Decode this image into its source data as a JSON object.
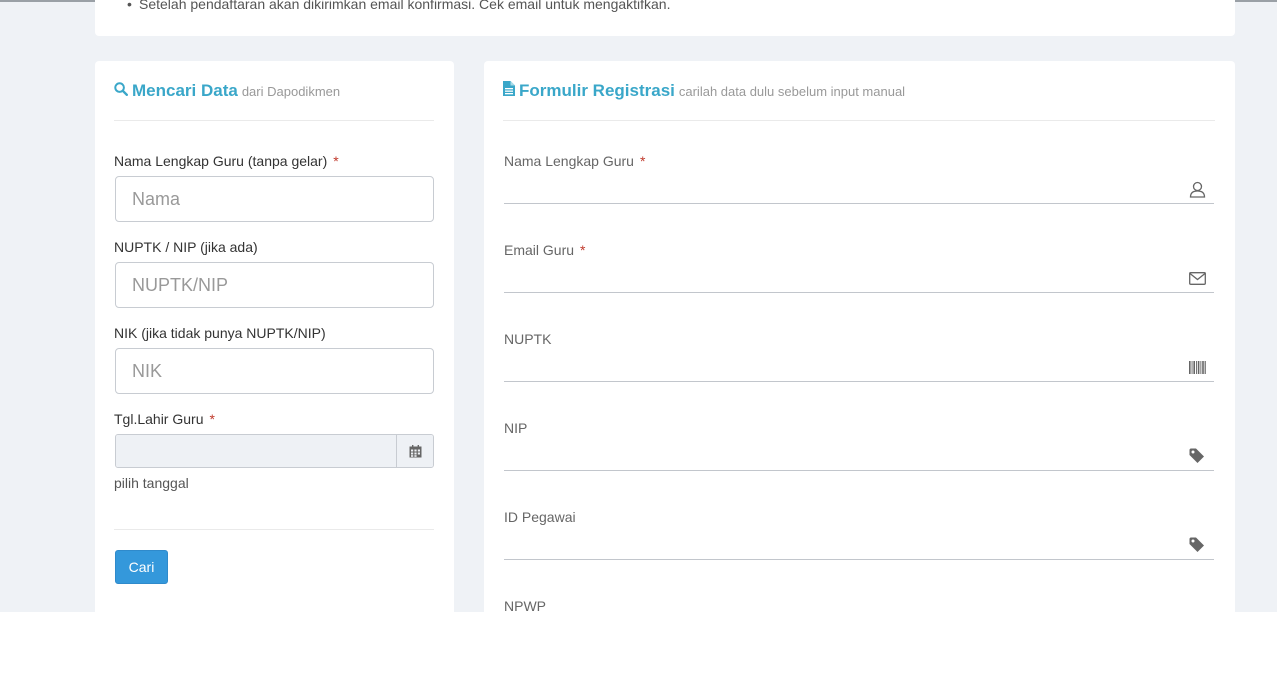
{
  "info": {
    "notice": "Setelah pendaftaran akan dikirimkan email konfirmasi. Cek email untuk mengaktifkan."
  },
  "search": {
    "title": "Mencari Data",
    "subtitle": "dari Dapodikmen",
    "fields": {
      "nama_label": "Nama Lengkap Guru (tanpa gelar)",
      "nama_placeholder": "Nama",
      "nuptk_label": "NUPTK / NIP (jika ada)",
      "nuptk_placeholder": "NUPTK/NIP",
      "nik_label": "NIK (jika tidak punya NUPTK/NIP)",
      "nik_placeholder": "NIK",
      "tgl_label": "Tgl.Lahir Guru",
      "tgl_help": "pilih tanggal"
    },
    "required_mark": "*",
    "button_label": "Cari"
  },
  "registration": {
    "title": "Formulir Registrasi",
    "subtitle": "carilah data dulu sebelum input manual",
    "fields": [
      {
        "label": "Nama Lengkap Guru",
        "required": "*",
        "icon": "user-icon"
      },
      {
        "label": "Email Guru",
        "required": "*",
        "icon": "envelope-icon"
      },
      {
        "label": "NUPTK",
        "required": "",
        "icon": "barcode-icon"
      },
      {
        "label": "NIP",
        "required": "",
        "icon": "tag-icon"
      },
      {
        "label": "ID Pegawai",
        "required": "",
        "icon": "tag-icon"
      },
      {
        "label": "NPWP",
        "required": "",
        "icon": ""
      }
    ]
  },
  "colors": {
    "accent": "#3aa7c9",
    "button": "#3498db",
    "required": "#c0392b",
    "background": "#eff2f6"
  }
}
